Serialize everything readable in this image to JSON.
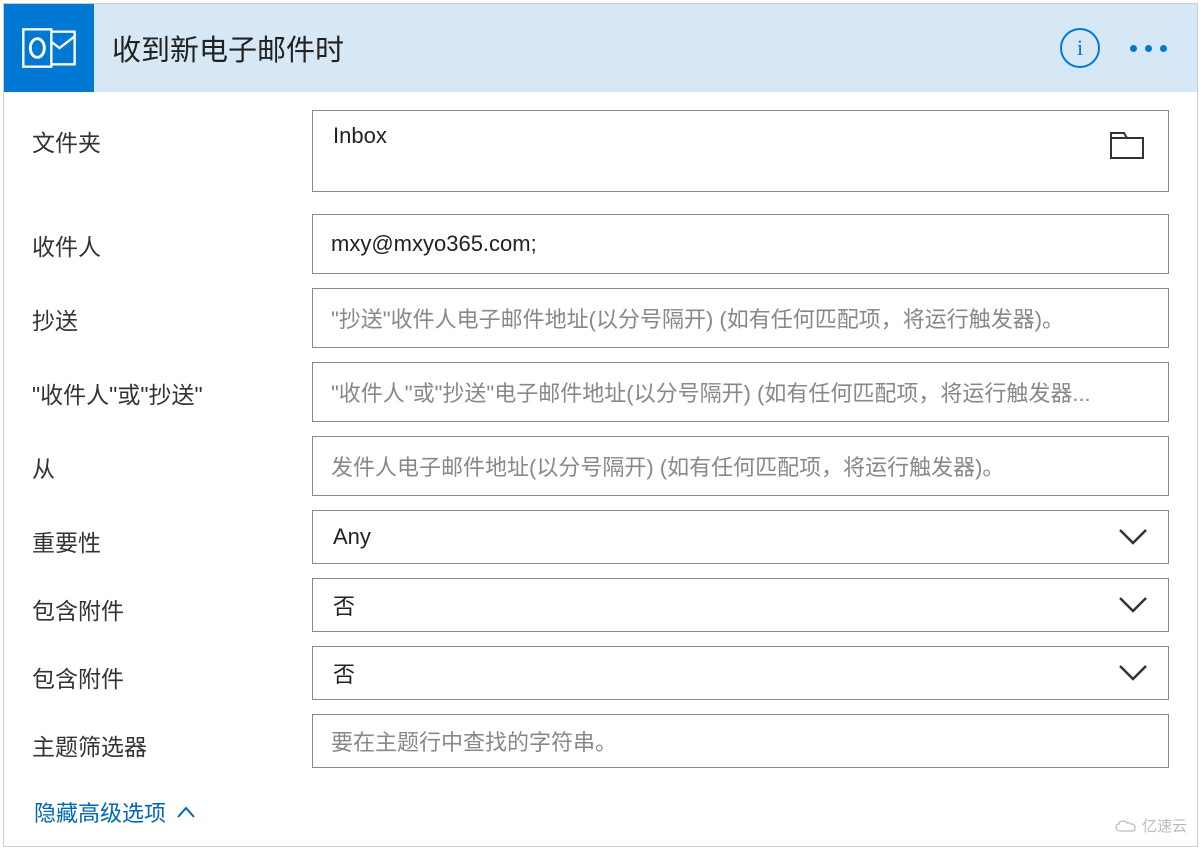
{
  "header": {
    "title": "收到新电子邮件时",
    "info_label": "i",
    "colors": {
      "brand": "#0078d4",
      "header_bg": "#d6e8f5"
    }
  },
  "fields": {
    "folder": {
      "label": "文件夹",
      "value": "Inbox"
    },
    "to": {
      "label": "收件人",
      "value": "mxy@mxyo365.com;"
    },
    "cc": {
      "label": "抄送",
      "placeholder": "\"抄送\"收件人电子邮件地址(以分号隔开) (如有任何匹配项，将运行触发器)。"
    },
    "to_or_cc": {
      "label": "\"收件人\"或\"抄送\"",
      "placeholder": "\"收件人\"或\"抄送\"电子邮件地址(以分号隔开) (如有任何匹配项，将运行触发器..."
    },
    "from": {
      "label": "从",
      "placeholder": "发件人电子邮件地址(以分号隔开) (如有任何匹配项，将运行触发器)。"
    },
    "importance": {
      "label": "重要性",
      "value": "Any"
    },
    "has_attachment_1": {
      "label": "包含附件",
      "value": "否"
    },
    "has_attachment_2": {
      "label": "包含附件",
      "value": "否"
    },
    "subject_filter": {
      "label": "主题筛选器",
      "placeholder": "要在主题行中查找的字符串。"
    }
  },
  "toggle": {
    "label": "隐藏高级选项"
  },
  "watermark": "亿速云"
}
